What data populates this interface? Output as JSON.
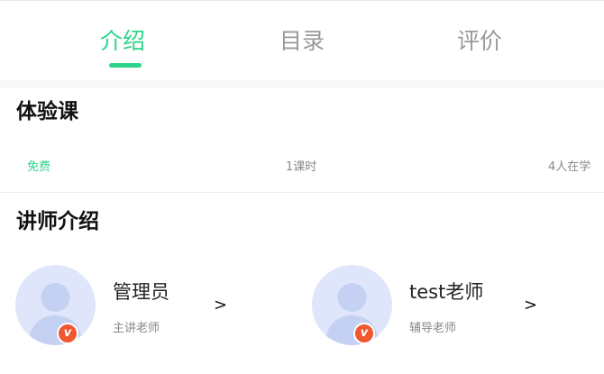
{
  "tabs": [
    {
      "label": "介绍",
      "active": true
    },
    {
      "label": "目录",
      "active": false
    },
    {
      "label": "评价",
      "active": false
    }
  ],
  "trial": {
    "title": "体验课",
    "price": "免费",
    "lessons": "1课时",
    "learners": "4人在学"
  },
  "teachers": {
    "title": "讲师介绍",
    "items": [
      {
        "name": "管理员",
        "role": "主讲老师",
        "badge": "v",
        "chevron": ">"
      },
      {
        "name": "test老师",
        "role": "辅导老师",
        "badge": "v",
        "chevron": ">"
      }
    ]
  },
  "colors": {
    "accent": "#2ed38b",
    "badge": "#f0582f",
    "avatar_bg": "#dfe6fb",
    "avatar_figure": "#c5d1f3"
  }
}
